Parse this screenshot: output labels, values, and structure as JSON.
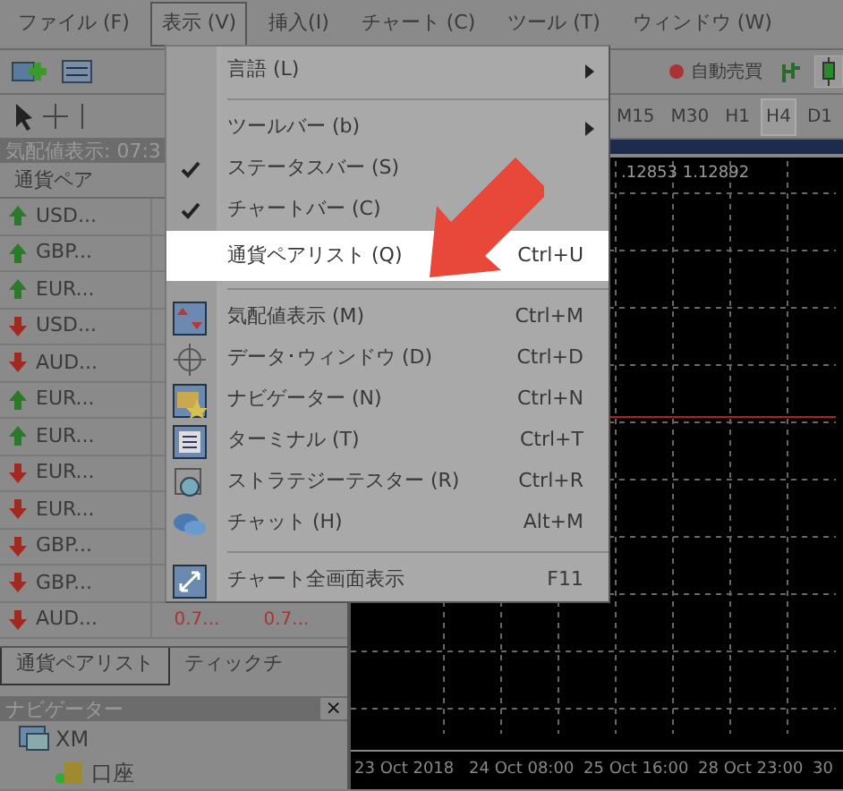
{
  "menubar": [
    {
      "label": "ファイル (F)",
      "selected": false
    },
    {
      "label": "表示 (V)",
      "selected": true
    },
    {
      "label": "挿入(I)",
      "selected": false
    },
    {
      "label": "チャート (C)",
      "selected": false
    },
    {
      "label": "ツール (T)",
      "selected": false
    },
    {
      "label": "ウィンドウ (W)",
      "selected": false
    }
  ],
  "toolbar": {
    "autotrade": "自動売買",
    "timeframes": [
      {
        "label": "M15",
        "selected": false
      },
      {
        "label": "M30",
        "selected": false
      },
      {
        "label": "H1",
        "selected": false
      },
      {
        "label": "H4",
        "selected": true
      },
      {
        "label": "D1",
        "selected": false
      }
    ]
  },
  "market_watch": {
    "title": "気配値表示: 07:3",
    "column_1": "通貨ペア",
    "rows": [
      {
        "symbol": "USD...",
        "kind": "rising"
      },
      {
        "symbol": "GBP...",
        "kind": "rising"
      },
      {
        "symbol": "EUR...",
        "kind": "rising"
      },
      {
        "symbol": "USD...",
        "kind": "falling"
      },
      {
        "symbol": "AUD...",
        "kind": "falling"
      },
      {
        "symbol": "EUR...",
        "kind": "rising"
      },
      {
        "symbol": "EUR...",
        "kind": "rising"
      },
      {
        "symbol": "EUR...",
        "kind": "falling"
      },
      {
        "symbol": "EUR...",
        "kind": "falling"
      },
      {
        "symbol": "GBP...",
        "kind": "falling"
      },
      {
        "symbol": "GBP...",
        "kind": "falling"
      },
      {
        "symbol": "AUD...",
        "kind": "falling",
        "bid": "0.7...",
        "ask": "0.7..."
      }
    ],
    "tabs": [
      {
        "label": "通貨ペアリスト",
        "selected": true
      },
      {
        "label": "ティックチ",
        "selected": false
      }
    ]
  },
  "navigator": {
    "title": "ナビゲーター",
    "close": "×",
    "tree": [
      {
        "label": "XM",
        "children": [
          {
            "label": "口座"
          }
        ]
      }
    ]
  },
  "chart": {
    "prices": ".12853 1.12892",
    "time_labels": [
      "23 Oct 2018",
      "24 Oct 08:00",
      "25 Oct 16:00",
      "28 Oct 23:00",
      "30"
    ]
  },
  "view_menu": [
    {
      "kind": "item",
      "label": "言語 (L)",
      "submenu": true,
      "checked": false,
      "selected": false
    },
    {
      "kind": "separator"
    },
    {
      "kind": "item",
      "label": "ツールバー (b)",
      "submenu": true,
      "checked": false,
      "selected": false
    },
    {
      "kind": "item",
      "label": "ステータスバー (S)",
      "checked": true,
      "selected": false
    },
    {
      "kind": "item",
      "label": "チャートバー (C)",
      "checked": true,
      "selected": false
    },
    {
      "kind": "item",
      "label": "通貨ペアリスト (Q)",
      "shortcut": "Ctrl+U",
      "checked": false,
      "selected": true
    },
    {
      "kind": "separator"
    },
    {
      "kind": "icon_item",
      "label": "気配値表示 (M)",
      "shortcut": "Ctrl+M",
      "checked": false,
      "selected": false
    },
    {
      "kind": "icon_item",
      "label": "データ･ウィンドウ (D)",
      "shortcut": "Ctrl+D",
      "checked": false,
      "selected": false
    },
    {
      "kind": "icon_item",
      "label": "ナビゲーター (N)",
      "shortcut": "Ctrl+N",
      "checked": false,
      "selected": false
    },
    {
      "kind": "icon_item",
      "label": "ターミナル (T)",
      "shortcut": "Ctrl+T",
      "checked": false,
      "selected": false
    },
    {
      "kind": "icon_item",
      "label": "ストラテジーテスター (R)",
      "shortcut": "Ctrl+R",
      "checked": false,
      "selected": false
    },
    {
      "kind": "icon_item",
      "label": "チャット (H)",
      "shortcut": "Alt+M",
      "checked": false,
      "selected": false
    },
    {
      "kind": "separator"
    },
    {
      "kind": "icon_item",
      "label": "チャート全画面表示",
      "shortcut": "F11",
      "checked": false,
      "selected": false
    }
  ]
}
